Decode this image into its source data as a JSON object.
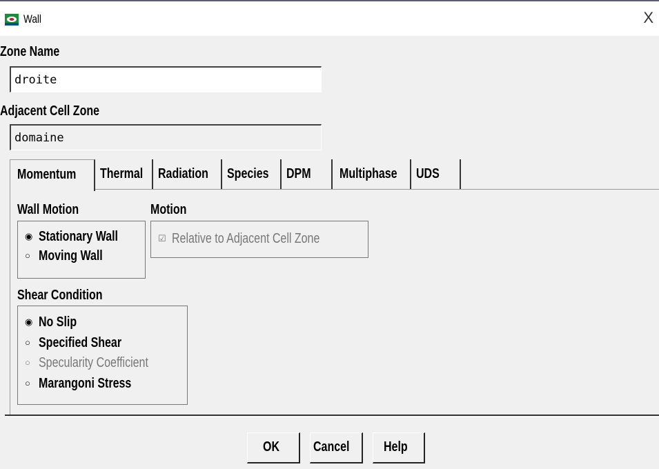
{
  "window": {
    "title": "Wall",
    "close_glyph": "X"
  },
  "zone_name": {
    "label": "Zone Name",
    "value": "droite"
  },
  "adjacent_cell_zone": {
    "label": "Adjacent Cell Zone",
    "value": "domaine"
  },
  "tabs": [
    {
      "label": "Momentum",
      "active": true
    },
    {
      "label": "Thermal",
      "active": false
    },
    {
      "label": "Radiation",
      "active": false
    },
    {
      "label": "Species",
      "active": false
    },
    {
      "label": "DPM",
      "active": false
    },
    {
      "label": "Multiphase",
      "active": false
    },
    {
      "label": "UDS",
      "active": false
    }
  ],
  "momentum": {
    "wall_motion": {
      "label": "Wall Motion",
      "options": [
        {
          "label": "Stationary Wall",
          "selected": true
        },
        {
          "label": "Moving Wall",
          "selected": false
        }
      ]
    },
    "motion": {
      "label": "Motion",
      "checkbox": {
        "label": "Relative to Adjacent Cell Zone",
        "checked": true,
        "enabled": false
      }
    },
    "shear_condition": {
      "label": "Shear Condition",
      "options": [
        {
          "label": "No Slip",
          "selected": true,
          "enabled": true
        },
        {
          "label": "Specified Shear",
          "selected": false,
          "enabled": true
        },
        {
          "label": "Specularity Coefficient",
          "selected": false,
          "enabled": false
        },
        {
          "label": "Marangoni Stress",
          "selected": false,
          "enabled": true
        }
      ]
    }
  },
  "buttons": {
    "ok": "OK",
    "cancel": "Cancel",
    "help": "Help"
  },
  "icons": {
    "app": "fluent-app-icon",
    "radio_on": "◉",
    "radio_off": "○",
    "checkbox_checked": "☑"
  }
}
